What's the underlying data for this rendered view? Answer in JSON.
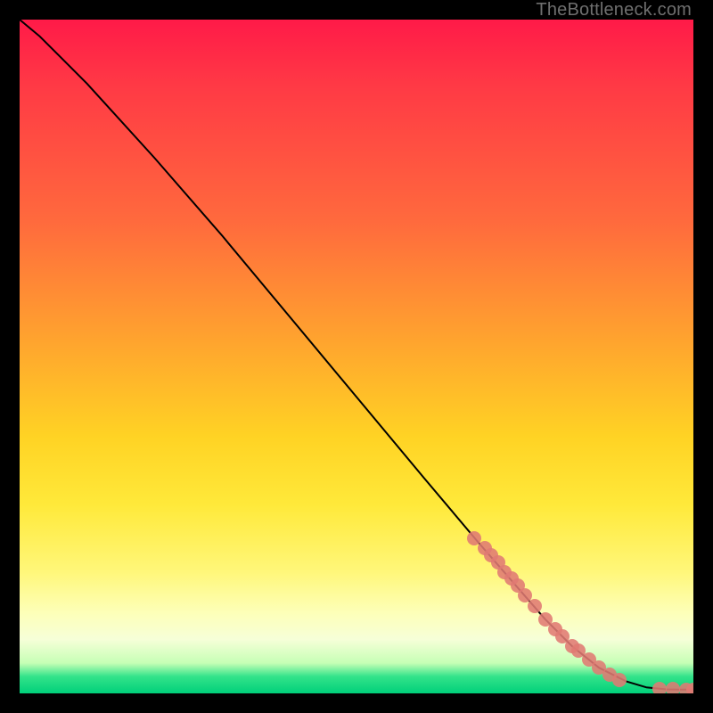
{
  "attribution": "TheBottleneck.com",
  "colors": {
    "dot": "#e07a73",
    "curve": "#000000",
    "background": "#000000"
  },
  "chart_data": {
    "type": "line",
    "title": "",
    "xlabel": "",
    "ylabel": "",
    "xlim": [
      0,
      100
    ],
    "ylim": [
      0,
      100
    ],
    "grid": false,
    "curve": [
      {
        "x": 0,
        "y": 100
      },
      {
        "x": 3,
        "y": 97.5
      },
      {
        "x": 6,
        "y": 94.5
      },
      {
        "x": 10,
        "y": 90.5
      },
      {
        "x": 20,
        "y": 79.5
      },
      {
        "x": 30,
        "y": 68
      },
      {
        "x": 40,
        "y": 56
      },
      {
        "x": 50,
        "y": 44
      },
      {
        "x": 60,
        "y": 32
      },
      {
        "x": 68,
        "y": 22.5
      },
      {
        "x": 78,
        "y": 11
      },
      {
        "x": 82,
        "y": 7
      },
      {
        "x": 86,
        "y": 3.8
      },
      {
        "x": 90,
        "y": 1.8
      },
      {
        "x": 93,
        "y": 0.9
      },
      {
        "x": 96,
        "y": 0.6
      },
      {
        "x": 98,
        "y": 0.55
      },
      {
        "x": 100,
        "y": 0.55
      }
    ],
    "series": [
      {
        "name": "highlighted-points",
        "points": [
          {
            "x": 67.5,
            "y": 23
          },
          {
            "x": 69,
            "y": 21.5
          },
          {
            "x": 70,
            "y": 20.5
          },
          {
            "x": 71,
            "y": 19.5
          },
          {
            "x": 72,
            "y": 18
          },
          {
            "x": 73,
            "y": 17
          },
          {
            "x": 74,
            "y": 16
          },
          {
            "x": 75,
            "y": 14.5
          },
          {
            "x": 76.5,
            "y": 13
          },
          {
            "x": 78,
            "y": 11
          },
          {
            "x": 79.5,
            "y": 9.5
          },
          {
            "x": 80.5,
            "y": 8.5
          },
          {
            "x": 82,
            "y": 7
          },
          {
            "x": 83,
            "y": 6.3
          },
          {
            "x": 84.5,
            "y": 5
          },
          {
            "x": 86,
            "y": 3.8
          },
          {
            "x": 87.5,
            "y": 2.8
          },
          {
            "x": 89,
            "y": 2
          },
          {
            "x": 95,
            "y": 0.7
          },
          {
            "x": 97,
            "y": 0.6
          },
          {
            "x": 99,
            "y": 0.55
          },
          {
            "x": 100,
            "y": 0.55
          }
        ]
      }
    ]
  }
}
